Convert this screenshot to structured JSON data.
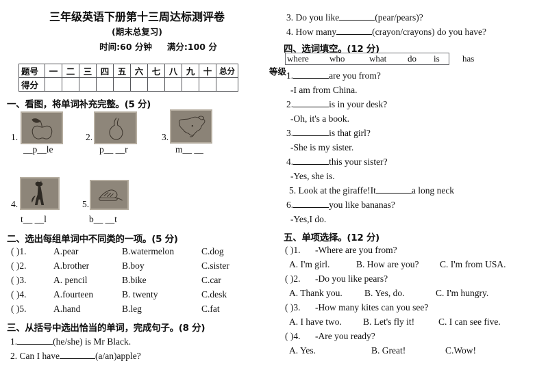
{
  "header": {
    "title": "三年级英语下册第十三周达标测评卷",
    "subtitle": "(期末总复习)",
    "time": "时间:60 分钟",
    "full_score": "满分:100 分"
  },
  "score_table": {
    "row_label_1": "题号",
    "row_label_2": "得分",
    "columns": [
      "一",
      "二",
      "三",
      "四",
      "五",
      "六",
      "七",
      "八",
      "九",
      "十"
    ],
    "total_label": "总分",
    "grade_label": "等级"
  },
  "section_one": {
    "heading": "一、看图，将单词补充完整。(5 分)",
    "items": [
      {
        "num": "1.",
        "answer": "__p__le",
        "icon": "apple-icon"
      },
      {
        "num": "2.",
        "answer": "p__ __r",
        "icon": "pear-icon"
      },
      {
        "num": "3.",
        "answer": "m__ __",
        "icon": "map-of-china-icon"
      },
      {
        "num": "4.",
        "answer": "t__ __l",
        "icon": "giraffe-icon"
      },
      {
        "num": "5.",
        "answer": "b__ __t",
        "icon": "boat-icon"
      }
    ]
  },
  "section_two": {
    "heading": "二、选出每组单词中不同类的一项。(5 分)",
    "items": [
      {
        "bracket": "(    )1.",
        "a": "A.pear",
        "b": "B.watermelon",
        "c": "C.dog"
      },
      {
        "bracket": "(    )2.",
        "a": "A.brother",
        "b": "B.boy",
        "c": "C.sister"
      },
      {
        "bracket": "(    )3.",
        "a": "A. pencil",
        "b": "B.bike",
        "c": "C.car"
      },
      {
        "bracket": "(    )4.",
        "a": "A.fourteen",
        "b": "B. twenty",
        "c": "C.desk"
      },
      {
        "bracket": "(    )5.",
        "a": "A.hand",
        "b": "B.leg",
        "c": "C.fat"
      }
    ]
  },
  "section_three": {
    "heading": "三、从括号中选出恰当的单词，完成句子。(8 分)",
    "items": [
      {
        "pre": "1.",
        "post": "(he/she) is Mr Black."
      },
      {
        "pre": "2. Can I have",
        "post": "(a/an)apple?"
      },
      {
        "pre": "3. Do you like",
        "post": "(pear/pears)?"
      },
      {
        "pre": "4. How many",
        "post": "(crayon/crayons) do you have?"
      }
    ]
  },
  "section_four": {
    "heading": "四、选词填空。(12 分)",
    "word_bank": [
      "where",
      "who",
      "what",
      "do",
      "is"
    ],
    "word_bank_outside": "has",
    "items": [
      {
        "pre": "1.",
        "post": "are you from?",
        "answer": "-I am from China."
      },
      {
        "pre": "2.",
        "post": "is in your desk?",
        "answer": "-Oh, it's a book."
      },
      {
        "pre": "3.",
        "post": "is that girl?",
        "answer": "-She is my sister."
      },
      {
        "pre": "4.",
        "post": "this your sister?",
        "answer": "-Yes, she is."
      },
      {
        "pre": "5. Look at the giraffe!It",
        "post": "a long neck",
        "answer": ""
      },
      {
        "pre": "6.",
        "post": "you like bananas?",
        "answer": "-Yes,I do."
      }
    ]
  },
  "section_five": {
    "heading": "五、单项选择。(12 分)",
    "items": [
      {
        "bracket": "(    )1.",
        "question": "-Where are you from?",
        "a": "A. I'm girl.",
        "b": "B. How are you?",
        "c": "C. I'm from USA."
      },
      {
        "bracket": "(    )2.",
        "question": "-Do you like pears?",
        "a": "A. Thank you.",
        "b": "B. Yes, do.",
        "c": "C. I'm hungry."
      },
      {
        "bracket": "(    )3.",
        "question": "-How many kites can you see?",
        "a": "A. I have two.",
        "b": "B. Let's fly it!",
        "c": "C. I can see five."
      },
      {
        "bracket": "(    )4.",
        "question": "-Are you ready?",
        "a": "A. Yes.",
        "b": "B. Great!",
        "c": "C.Wow!"
      }
    ]
  }
}
